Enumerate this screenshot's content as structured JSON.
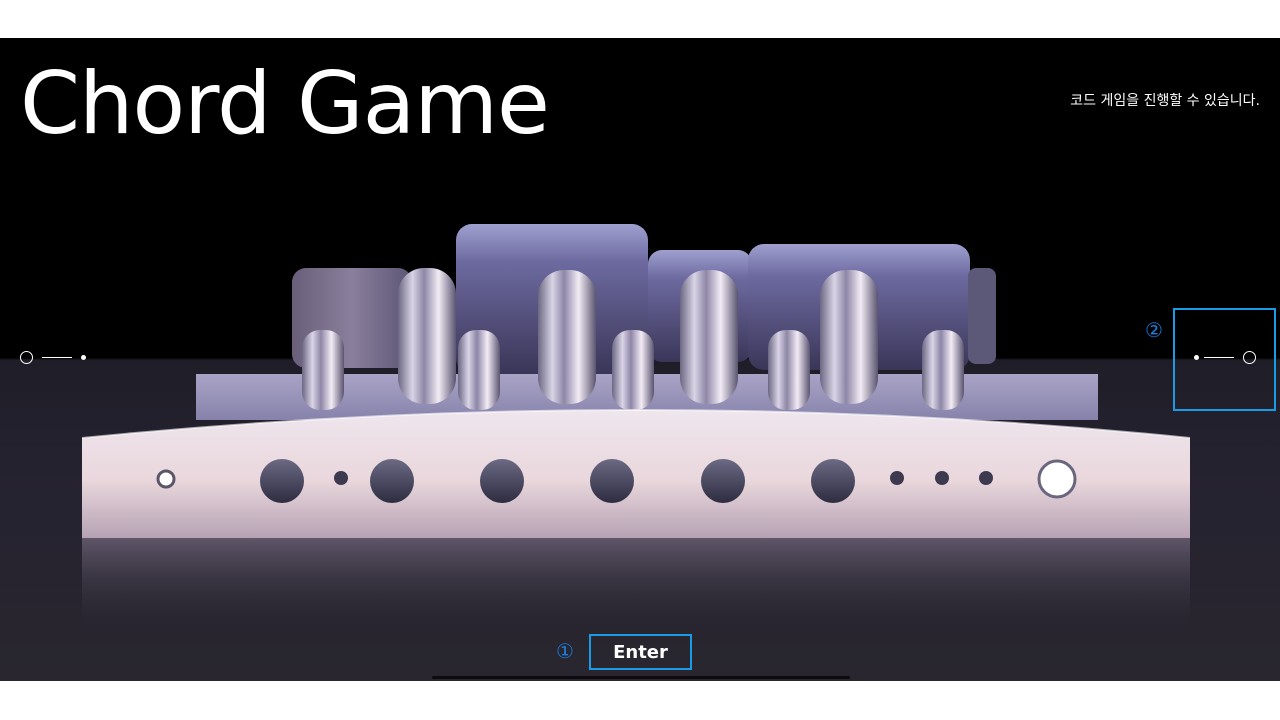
{
  "app": {
    "title": "Chord Game",
    "subtitle": "코드 게임을 진행할 수 있습니다.",
    "enter_label": "Enter"
  },
  "annotations": {
    "marker_1": "①",
    "marker_2": "②"
  },
  "navigation": {
    "prev_icon": "carousel-prev-indicator-icon",
    "next_icon": "carousel-next-indicator-icon"
  },
  "colors": {
    "highlight": "#1b9be6",
    "marker": "#1b7fe0",
    "background": "#000000",
    "text": "#ffffff"
  }
}
